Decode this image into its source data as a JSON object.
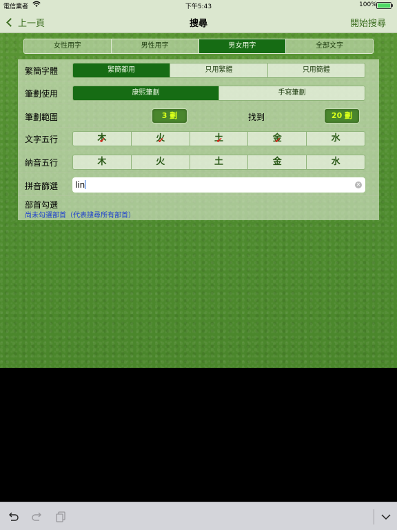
{
  "status_bar": {
    "carrier": "電信業者",
    "time": "下午5:43",
    "battery": "100%"
  },
  "nav": {
    "back_label": "上一頁",
    "title": "搜尋",
    "action_label": "開始搜尋"
  },
  "gender_tabs": {
    "items": [
      "女性用字",
      "男性用字",
      "男女用字",
      "全部文字"
    ],
    "selected": "男女用字"
  },
  "script_row": {
    "label": "繁簡字體",
    "options": [
      "繁簡都用",
      "只用繁體",
      "只用簡體"
    ],
    "selected": "繁簡都用"
  },
  "stroke_row": {
    "label": "筆劃使用",
    "options": [
      "康熙筆劃",
      "手寫筆劃"
    ],
    "selected": "康熙筆劃"
  },
  "range_row": {
    "label": "筆劃範圍",
    "min": "3 劃",
    "found_label": "找到",
    "max": "20 劃"
  },
  "element_row": {
    "label": "文字五行",
    "items": [
      "木",
      "火",
      "土",
      "金",
      "水"
    ],
    "checked": [
      "木",
      "火",
      "土",
      "金"
    ],
    "check_mark": "✔"
  },
  "sound_row": {
    "label": "納音五行",
    "items": [
      "木",
      "火",
      "土",
      "金",
      "水"
    ]
  },
  "pinyin_row": {
    "label": "拼音篩選",
    "value": "lin"
  },
  "radical_row": {
    "label": "部首勾選",
    "note": "尚未勾選部首（代表搜尋所有部首）"
  },
  "colors": {
    "accent_green": "#166c14",
    "nav_tint": "#3d6f21",
    "pill_text": "#d8ff1a",
    "check_red": "#d9261c",
    "note_blue": "#1d3fcf"
  },
  "toolbar": {
    "icons": [
      "undo-icon",
      "redo-icon",
      "paste-icon",
      "chevron-down-icon"
    ]
  }
}
